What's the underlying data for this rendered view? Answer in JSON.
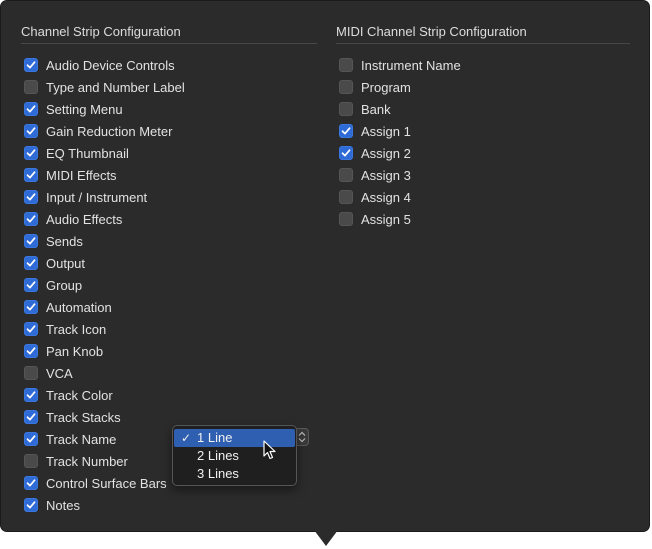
{
  "left_section": {
    "title": "Channel Strip Configuration",
    "items": [
      {
        "label": "Audio Device Controls",
        "checked": true
      },
      {
        "label": "Type and Number Label",
        "checked": false
      },
      {
        "label": "Setting Menu",
        "checked": true
      },
      {
        "label": "Gain Reduction Meter",
        "checked": true
      },
      {
        "label": "EQ Thumbnail",
        "checked": true
      },
      {
        "label": "MIDI Effects",
        "checked": true
      },
      {
        "label": "Input / Instrument",
        "checked": true
      },
      {
        "label": "Audio Effects",
        "checked": true
      },
      {
        "label": "Sends",
        "checked": true
      },
      {
        "label": "Output",
        "checked": true
      },
      {
        "label": "Group",
        "checked": true
      },
      {
        "label": "Automation",
        "checked": true
      },
      {
        "label": "Track Icon",
        "checked": true
      },
      {
        "label": "Pan Knob",
        "checked": true
      },
      {
        "label": "VCA",
        "checked": false
      },
      {
        "label": "Track Color",
        "checked": true
      },
      {
        "label": "Track Stacks",
        "checked": true
      },
      {
        "label": "Track Name",
        "checked": true
      },
      {
        "label": "Track Number",
        "checked": false
      },
      {
        "label": "Control Surface Bars",
        "checked": true
      },
      {
        "label": "Notes",
        "checked": true
      }
    ]
  },
  "right_section": {
    "title": "MIDI Channel Strip Configuration",
    "items": [
      {
        "label": "Instrument Name",
        "checked": false
      },
      {
        "label": "Program",
        "checked": false
      },
      {
        "label": "Bank",
        "checked": false
      },
      {
        "label": "Assign 1",
        "checked": true
      },
      {
        "label": "Assign 2",
        "checked": true
      },
      {
        "label": "Assign 3",
        "checked": false
      },
      {
        "label": "Assign 4",
        "checked": false
      },
      {
        "label": "Assign 5",
        "checked": false
      }
    ]
  },
  "track_name_menu": {
    "check_glyph": "✓",
    "options": [
      {
        "label": "1 Line",
        "selected": true
      },
      {
        "label": "2 Lines",
        "selected": false
      },
      {
        "label": "3 Lines",
        "selected": false
      }
    ]
  },
  "colors": {
    "panel_bg": "#2b2b2b",
    "checkbox_on": "#2e6bd6",
    "checkbox_off": "#4a4a4a",
    "menu_highlight": "#2f5fb0"
  },
  "icons": {
    "checkmark": "checkmark-icon",
    "popup_arrows": "up-down-chevron-icon",
    "cursor": "mouse-pointer-icon"
  }
}
